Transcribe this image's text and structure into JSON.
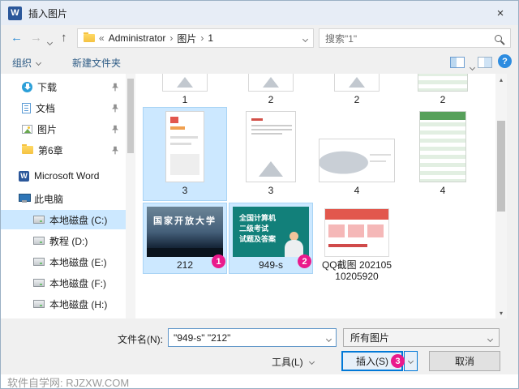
{
  "window": {
    "title": "插入图片",
    "close": "×"
  },
  "icons": {
    "back": "←",
    "forward": "→",
    "up": "↑",
    "scroll_up": "▴",
    "scroll_down": "▾"
  },
  "nav": {
    "address": {
      "prefix": "«",
      "sep": "›",
      "segments": [
        "Administrator",
        "图片",
        "1"
      ]
    },
    "search_text": "搜索\"1\""
  },
  "toolbar": {
    "organize": "组织",
    "new_folder": "新建文件夹",
    "help": "?"
  },
  "sidebar": {
    "items": [
      {
        "label": "下载"
      },
      {
        "label": "文档"
      },
      {
        "label": "图片"
      },
      {
        "label": "第6章"
      },
      {
        "label": "Microsoft Word"
      },
      {
        "label": "此电脑"
      },
      {
        "label": "本地磁盘 (C:)"
      },
      {
        "label": "教程 (D:)"
      },
      {
        "label": "本地磁盘 (E:)"
      },
      {
        "label": "本地磁盘 (F:)"
      },
      {
        "label": "本地磁盘 (H:)"
      }
    ]
  },
  "files": {
    "row1": [
      {
        "label": "1"
      },
      {
        "label": "2"
      },
      {
        "label": "2"
      },
      {
        "label": "2"
      }
    ],
    "row2": [
      {
        "label": "3"
      },
      {
        "label": "3"
      },
      {
        "label": "4"
      },
      {
        "label": "4"
      }
    ],
    "row3": [
      {
        "label": "212",
        "badge": "1"
      },
      {
        "label": "949-s",
        "badge": "2"
      },
      {
        "label": "QQ截图 20210510205920"
      }
    ]
  },
  "thumbs": {
    "t212": "国家开放大学",
    "t949_1": "全国计算机",
    "t949_2": "二级考试",
    "t949_3": "试题及答案"
  },
  "footer": {
    "filename_label": "文件名(N):",
    "filename_value": "\"949-s\" \"212\"",
    "filetype_value": "所有图片",
    "tools_label": "工具(L)",
    "insert_label": "插入(S)",
    "insert_badge": "3",
    "cancel_label": "取消"
  },
  "watermark": {
    "text": "软件自学网: RJZXW.COM"
  },
  "colors": {
    "accent": "#0078d7",
    "selection": "#cce8ff",
    "badge": "#ea1a8c"
  }
}
